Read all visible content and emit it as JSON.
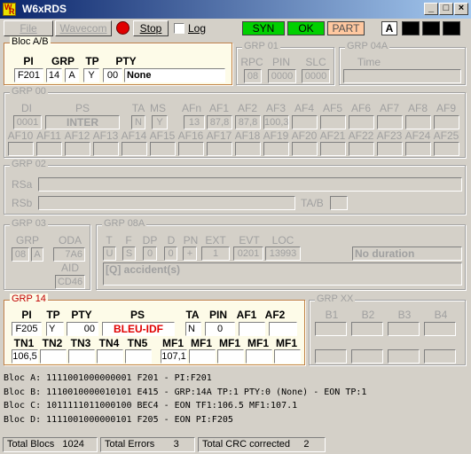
{
  "window": {
    "title": "W6xRDS"
  },
  "toolbar": {
    "file": "File",
    "wavecom": "Wavecom",
    "stop": "Stop",
    "log": "Log"
  },
  "status": {
    "syn": "SYN",
    "ok": "OK",
    "part": "PART",
    "a": "A"
  },
  "bloc_ab": {
    "title": "Bloc A/B",
    "labels": {
      "pi": "PI",
      "grp": "GRP",
      "tp": "TP",
      "pty": "PTY"
    },
    "pi": "F201",
    "grp": "14",
    "grp_ver": "A",
    "tp": "Y",
    "pty_code": "00",
    "pty_name": "None"
  },
  "grp01": {
    "title": "GRP 01",
    "labels": {
      "rpc": "RPC",
      "pin": "PIN",
      "slc": "SLC"
    },
    "rpc": "08",
    "pin": "0000",
    "slc": "0000"
  },
  "grp04a": {
    "title": "GRP 04A",
    "time_label": "Time",
    "time": ""
  },
  "grp00": {
    "title": "GRP 00",
    "labels": {
      "di": "DI",
      "ps": "PS",
      "ta": "TA",
      "ms": "MS",
      "afn": "AFn"
    },
    "di": "0001",
    "ps": "INTER",
    "ta": "N",
    "ms": "Y",
    "afn": "13",
    "af_labels": [
      "AF1",
      "AF2",
      "AF3",
      "AF4",
      "AF5",
      "AF6",
      "AF7",
      "AF8",
      "AF9",
      "AF10",
      "AF11",
      "AF12",
      "AF13",
      "AF14",
      "AF15",
      "AF16",
      "AF17",
      "AF18",
      "AF19",
      "AF20",
      "AF21",
      "AF22",
      "AF23",
      "AF24",
      "AF25"
    ],
    "af_values": [
      "87,8",
      "87,8",
      "100,3",
      "",
      "",
      "",
      "",
      "",
      "",
      "",
      "",
      "",
      "",
      "",
      "",
      "",
      "",
      "",
      "",
      "",
      "",
      "",
      "",
      "",
      ""
    ]
  },
  "grp02": {
    "title": "GRP 02",
    "rsa": "RSa",
    "rsb": "RSb",
    "tab": "TA/B"
  },
  "grp03": {
    "title": "GRP 03",
    "labels": {
      "grp": "GRP",
      "oda": "ODA",
      "aid": "AID"
    },
    "grp": "08",
    "grp_ver": "A",
    "oda": "7A6",
    "aid": "CD46"
  },
  "grp08a": {
    "title": "GRP 08A",
    "labels": {
      "t": "T",
      "f": "F",
      "dp": "DP",
      "d": "D",
      "pn": "PN",
      "ext": "EXT",
      "evt": "EVT",
      "loc": "LOC"
    },
    "t": "U",
    "f": "S",
    "dp": "0",
    "d": "0",
    "pn": "+",
    "ext": "1",
    "evt": "0201",
    "loc": "13993",
    "duration": "No duration",
    "message": "[Q] accident(s)"
  },
  "grp14": {
    "title": "GRP 14",
    "labels": {
      "pi": "PI",
      "tp": "TP",
      "pty": "PTY",
      "ps": "PS",
      "ta": "TA",
      "pin": "PIN",
      "af1": "AF1",
      "af2": "AF2"
    },
    "pi": "F205",
    "tp": "Y",
    "pty": "00",
    "ps": "BLEU-IDF",
    "ta": "N",
    "pin": "0",
    "tn_labels": [
      "TN1",
      "TN2",
      "TN3",
      "TN4",
      "TN5"
    ],
    "tn_values": [
      "106,5",
      "",
      "",
      "",
      ""
    ],
    "mf_labels": [
      "MF1",
      "MF1",
      "MF1",
      "MF1",
      "MF1"
    ],
    "mf_values": [
      "107,1",
      "",
      "",
      "",
      ""
    ]
  },
  "grpxx": {
    "title": "GRP XX",
    "labels": [
      "B1",
      "B2",
      "B3",
      "B4"
    ]
  },
  "log": [
    "Bloc A: 1111001000000001 F201 - PI:F201",
    "Bloc B: 1110010000010101 E415 - GRP:14A TP:1 PTY:0 (None) - EON TP:1",
    "Bloc C: 1011111011000100 BEC4 - EON TF1:106.5 MF1:107.1",
    "Bloc D: 1111001000000101 F205 - EON PI:F205"
  ],
  "statusbar": {
    "total_blocs_label": "Total Blocs",
    "total_blocs": "1024",
    "total_errors_label": "Total Errors",
    "total_errors": "3",
    "total_crc_label": "Total CRC corrected",
    "total_crc": "2"
  }
}
